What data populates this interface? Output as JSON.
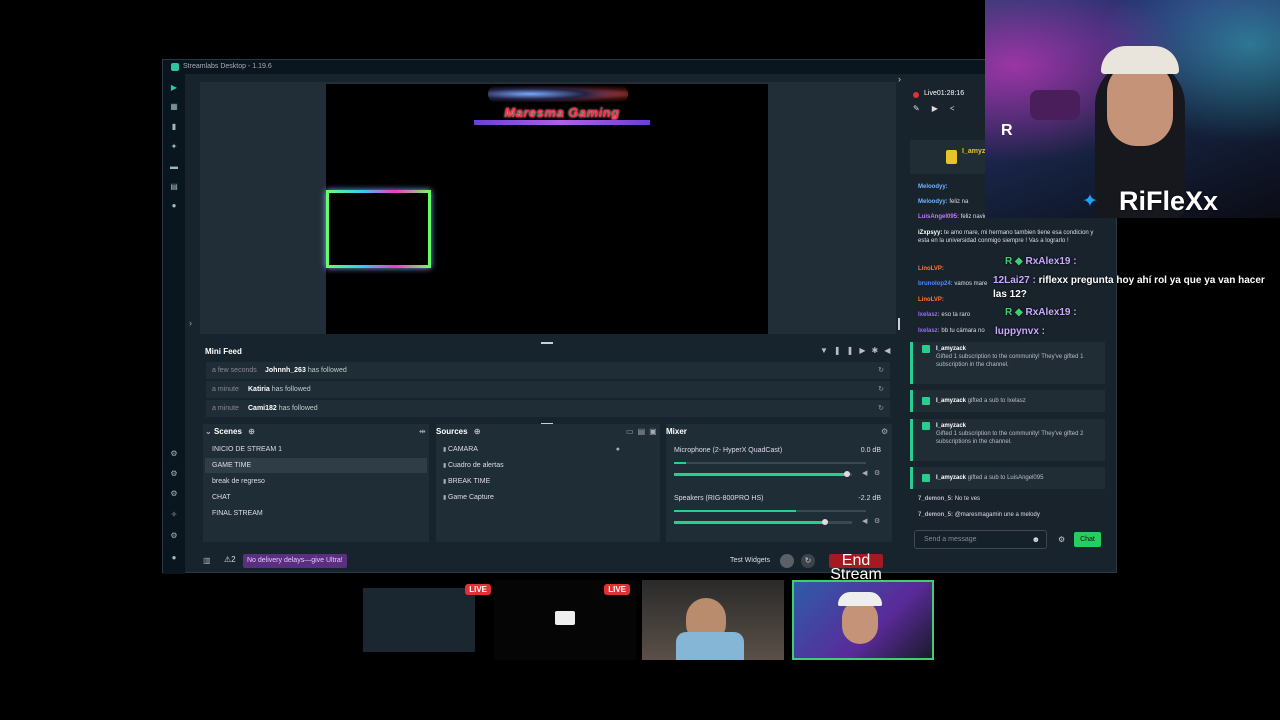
{
  "app": {
    "title": "Streamlabs Desktop - 1.19.6"
  },
  "preview": {
    "brand_title": "Maresma Gaming"
  },
  "minifeed": {
    "title": "Mini Feed",
    "rows": [
      {
        "time": "a few seconds",
        "user": "Johnnh_263",
        "action": "has followed"
      },
      {
        "time": "a minute",
        "user": "Katiria",
        "action": "has followed"
      },
      {
        "time": "a minute",
        "user": "Cami182",
        "action": "has followed"
      }
    ]
  },
  "scenes": {
    "title": "Scenes",
    "items": [
      "INICIO DE STREAM 1",
      "GAME TIME",
      "break de regreso",
      "CHAT",
      "FINAL STREAM"
    ],
    "selected_index": 1
  },
  "sources": {
    "title": "Sources",
    "items": [
      "CAMARA",
      "Cuadro de alertas",
      "BREAK TIME",
      "Game Capture"
    ]
  },
  "mixer": {
    "title": "Mixer",
    "channels": [
      {
        "name": "Microphone (2- HyperX QuadCast)",
        "db": "0.0 dB",
        "level": 0.97
      },
      {
        "name": "Speakers (RIG-800PRO HS)",
        "db": "-2.2 dB",
        "level": 0.85
      }
    ]
  },
  "footer": {
    "alert_count": "2",
    "delay_badge": "No delivery delays—give Ultra!",
    "test_widgets": "Test Widgets",
    "end_stream": "End Stream"
  },
  "live": {
    "label": "Live",
    "time": "01:28:16"
  },
  "chat": {
    "top_user": "I_amyza",
    "lines": [
      {
        "user": "Meloodyy:",
        "text": "",
        "color": "#6fb4ff"
      },
      {
        "user": "Meloodyy:",
        "text": "feliz na",
        "color": "#6fb4ff"
      },
      {
        "user": "LuisAngel095:",
        "text": "feliz navidad",
        "color": "#c178ff"
      },
      {
        "user": "iZxpsyy:",
        "text": "te amo mare, mi hermano tambien tiene esa condicion y esta en la universidad conmigo siempre ! Vas a lograrlo !",
        "color": "#ffffff"
      },
      {
        "user": "LinoLVP:",
        "text": "",
        "color": "#ff7a2f"
      },
      {
        "user": "brunolop24:",
        "text": "vamos mare",
        "color": "#4a8cff"
      },
      {
        "user": "LinoLVP:",
        "text": "",
        "color": "#ff7a2f"
      },
      {
        "user": "Ixelasz:",
        "text": "eso ta raro",
        "color": "#9b6bff"
      },
      {
        "user": "Ixelasz:",
        "text": "bb tu cámara no",
        "color": "#9b6bff"
      }
    ],
    "subs": [
      {
        "user": "I_amyzack",
        "text": "Gifted 1 subscription to the community! They've gifted 1 subscription in the channel."
      },
      {
        "user": "I_amyzack",
        "text": "gifted a sub to Ixelasz"
      },
      {
        "user": "I_amyzack",
        "text": "Gifted 1 subscription to the community! They've gifted 2 subscriptions in the channel."
      },
      {
        "user": "I_amyzack",
        "text": "gifted a sub to LuisAngel095"
      }
    ],
    "bottom_lines": [
      {
        "user": "7_demon_5:",
        "text": "No te ves"
      },
      {
        "user": "7_demon_5:",
        "text": "@maresmagamin une a melody"
      }
    ],
    "input_placeholder": "Send a message",
    "send_label": "Chat"
  },
  "overlay": {
    "handle": "RiFleXx",
    "msg1_user": "RxAlex19 :",
    "msg2_user": "12Lai27 :",
    "msg2_text": "riflexx pregunta hoy ahí rol ya que ya van hacer las 12?",
    "msg3_user": "RxAlex19 :",
    "msg4_user": "luppynvx :"
  },
  "thumbnails": {
    "live_label": "LIVE"
  }
}
